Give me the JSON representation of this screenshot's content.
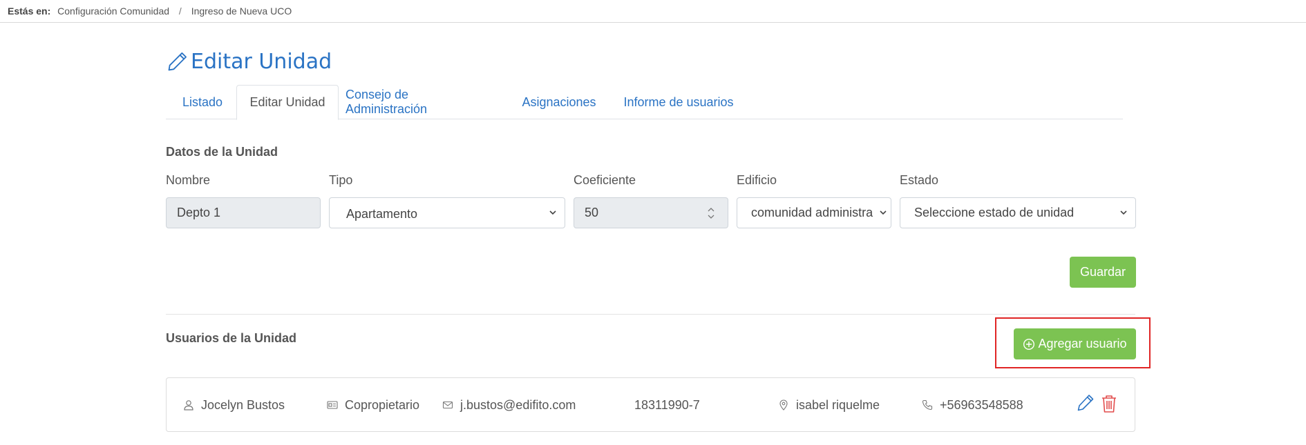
{
  "breadcrumb": {
    "prefix": "Estás en:",
    "items": [
      "Configuración Comunidad",
      "Ingreso de Nueva UCO"
    ],
    "separator": "/"
  },
  "page": {
    "title": "Editar Unidad",
    "title_icon": "pencil-icon"
  },
  "tabs": [
    {
      "label": "Listado",
      "active": false
    },
    {
      "label": "Editar Unidad",
      "active": true
    },
    {
      "label": "Consejo de Administración",
      "active": false
    },
    {
      "label": "Asignaciones",
      "active": false
    },
    {
      "label": "Informe de usuarios",
      "active": false
    }
  ],
  "unit_section": {
    "title": "Datos de la Unidad",
    "fields": {
      "nombre": {
        "label": "Nombre",
        "value": "Depto 1"
      },
      "tipo": {
        "label": "Tipo",
        "value": "Apartamento"
      },
      "coeficiente": {
        "label": "Coeficiente",
        "value": "50"
      },
      "edificio": {
        "label": "Edificio",
        "value": "comunidad administra"
      },
      "estado": {
        "label": "Estado",
        "value": "Seleccione estado de unidad"
      }
    },
    "save_label": "Guardar"
  },
  "users_section": {
    "title": "Usuarios de la Unidad",
    "add_label": "Agregar usuario",
    "users": [
      {
        "name": "Jocelyn Bustos",
        "role": "Copropietario",
        "email": "j.bustos@edifito.com",
        "rut": "18311990-7",
        "address": "isabel riquelme",
        "phone": "+56963548588"
      }
    ]
  },
  "colors": {
    "link_blue": "#2a73c4",
    "primary_green": "#7cc352",
    "delete_red": "#e24b4b",
    "highlight_red": "#e02424"
  }
}
